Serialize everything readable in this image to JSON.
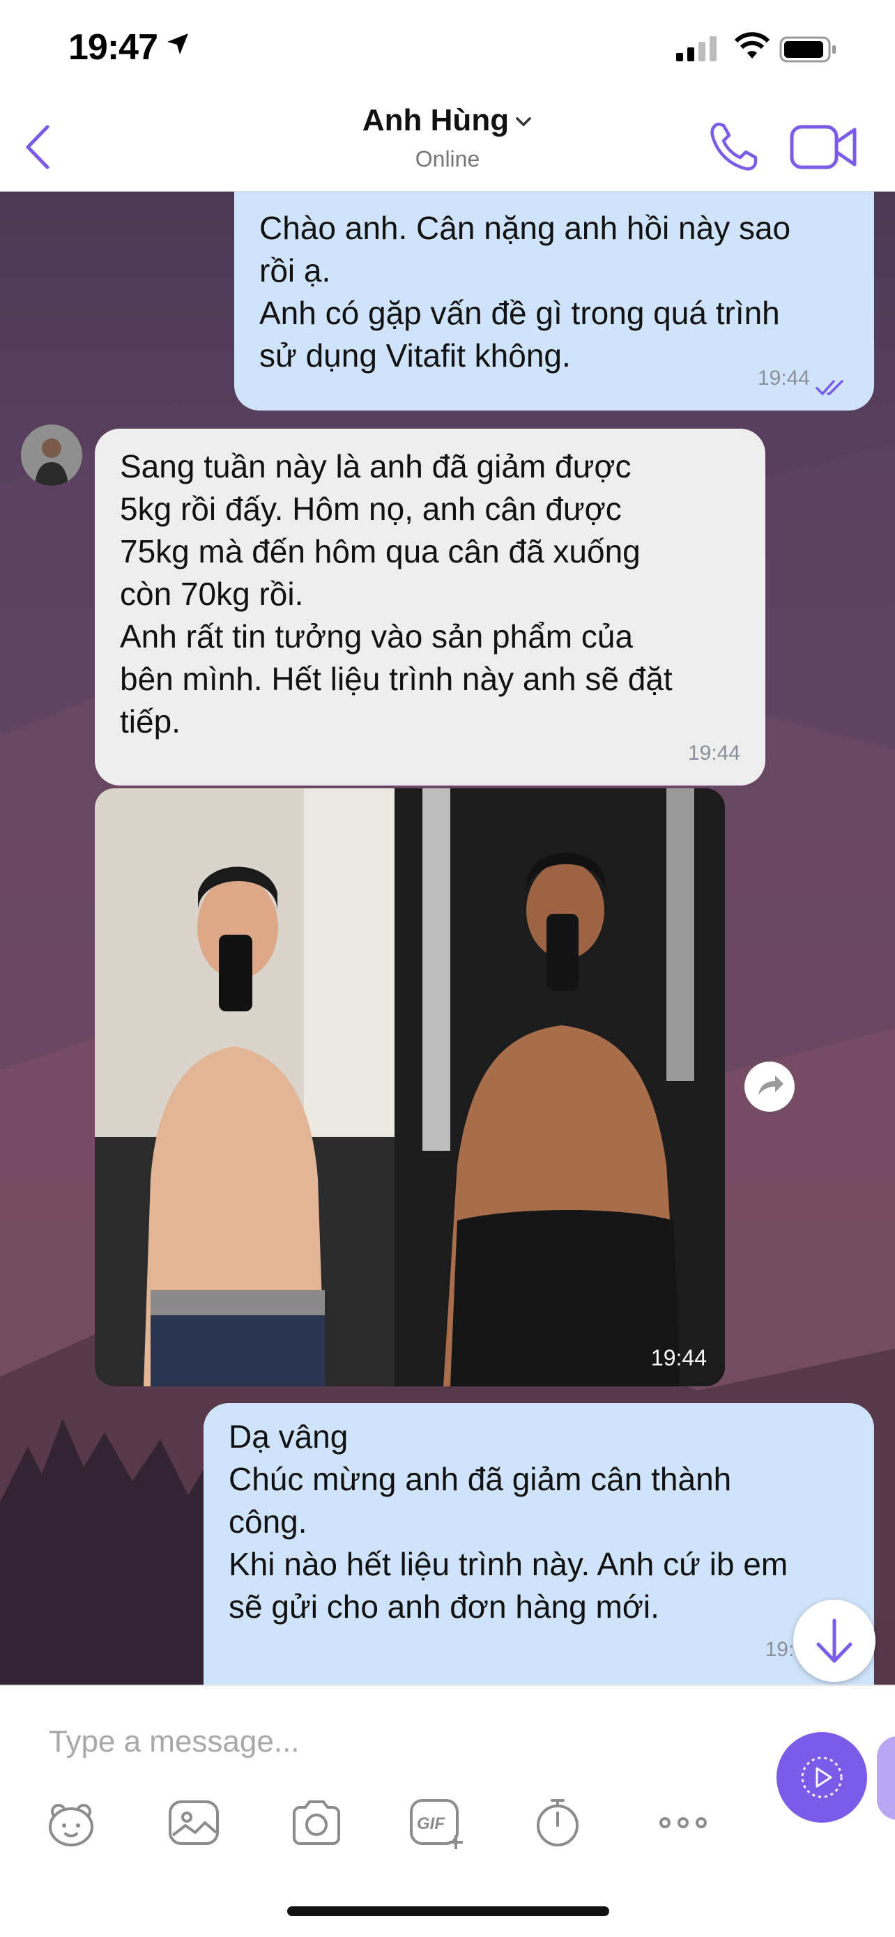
{
  "status_bar": {
    "time": "19:47"
  },
  "header": {
    "contact_name": "Anh Hùng",
    "contact_status": "Online"
  },
  "messages": [
    {
      "direction": "outgoing",
      "text": "Chào anh. Cân nặng anh hồi này sao\nrồi ạ.\nAnh có gặp vấn đề gì trong quá trình\nsử dụng  Vitafit  không.",
      "time": "19:44",
      "read": true
    },
    {
      "direction": "incoming",
      "text": "Sang tuần này là anh đã giảm được\n5kg rồi đấy. Hôm nọ, anh cân được\n75kg mà đến hôm qua cân đã xuống\ncòn 70kg rồi.\nAnh rất tin tưởng vào sản phẩm của\nbên mình. Hết liệu trình này anh sẽ đặt\ntiếp.",
      "time": "19:44"
    },
    {
      "direction": "incoming",
      "type": "photo",
      "time": "19:44"
    },
    {
      "direction": "outgoing",
      "text": "Dạ vâng\nChúc mừng anh đã giảm cân thành\ncông.\nKhi nào hết liệu trình này. Anh cứ ib em\nsẽ gửi cho anh đơn hàng mới.",
      "time": "19:4"
    }
  ],
  "composer": {
    "placeholder": "Type a message..."
  },
  "toolbar": {
    "gif_label": "GIF",
    "icons": [
      "sticker-icon",
      "gallery-icon",
      "camera-icon",
      "gif-icon",
      "timer-icon",
      "more-icon"
    ]
  },
  "colors": {
    "accent": "#7b5ce8",
    "outgoing_bubble": "#cfe3fb",
    "incoming_bubble": "#eeeeee"
  }
}
